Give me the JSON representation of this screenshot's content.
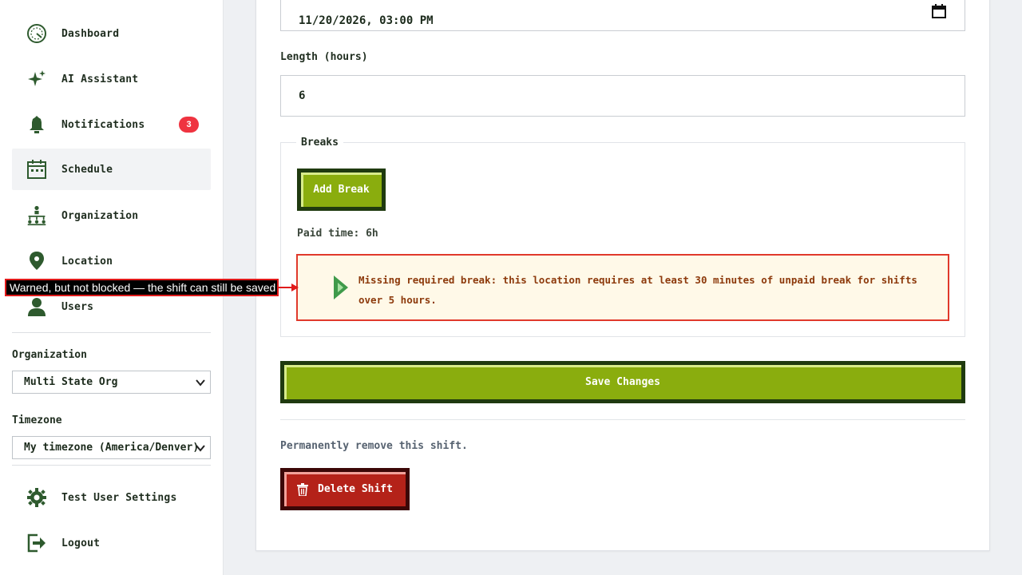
{
  "sidebar": {
    "items": [
      {
        "label": "Dashboard",
        "icon": "dashboard-gauge-icon"
      },
      {
        "label": "AI Assistant",
        "icon": "sparkle-icon"
      },
      {
        "label": "Notifications",
        "icon": "bell-icon",
        "badge": "3"
      },
      {
        "label": "Schedule",
        "icon": "calendar-icon",
        "active": true
      },
      {
        "label": "Organization",
        "icon": "org-chart-icon"
      },
      {
        "label": "Location",
        "icon": "map-pin-icon"
      },
      {
        "label": "Users",
        "icon": "user-icon"
      }
    ],
    "organization_label": "Organization",
    "organization_value": "Multi State Org",
    "timezone_label": "Timezone",
    "timezone_value": "My timezone (America/Denver)",
    "settings_label": "Test User Settings",
    "logout_label": "Logout"
  },
  "form": {
    "datetime_value": "11/20/2026, 03:00 PM",
    "length_label": "Length (hours)",
    "length_value": "6",
    "breaks_legend": "Breaks",
    "add_break_label": "Add Break",
    "paid_time": "Paid time: 6h",
    "warning_text": "Missing required break: this location requires at least 30 minutes of unpaid break for shifts over 5 hours.",
    "save_label": "Save Changes",
    "remove_text": "Permanently remove this shift.",
    "delete_label": "Delete Shift"
  },
  "annotation": {
    "text": "Warned, but not blocked — the shift can still be saved"
  },
  "colors": {
    "accent_green": "#8aad0e",
    "dark_green": "#1f3a0f",
    "danger_red": "#b42219",
    "warning_border": "#e0392b",
    "badge_red": "#ef3340"
  }
}
